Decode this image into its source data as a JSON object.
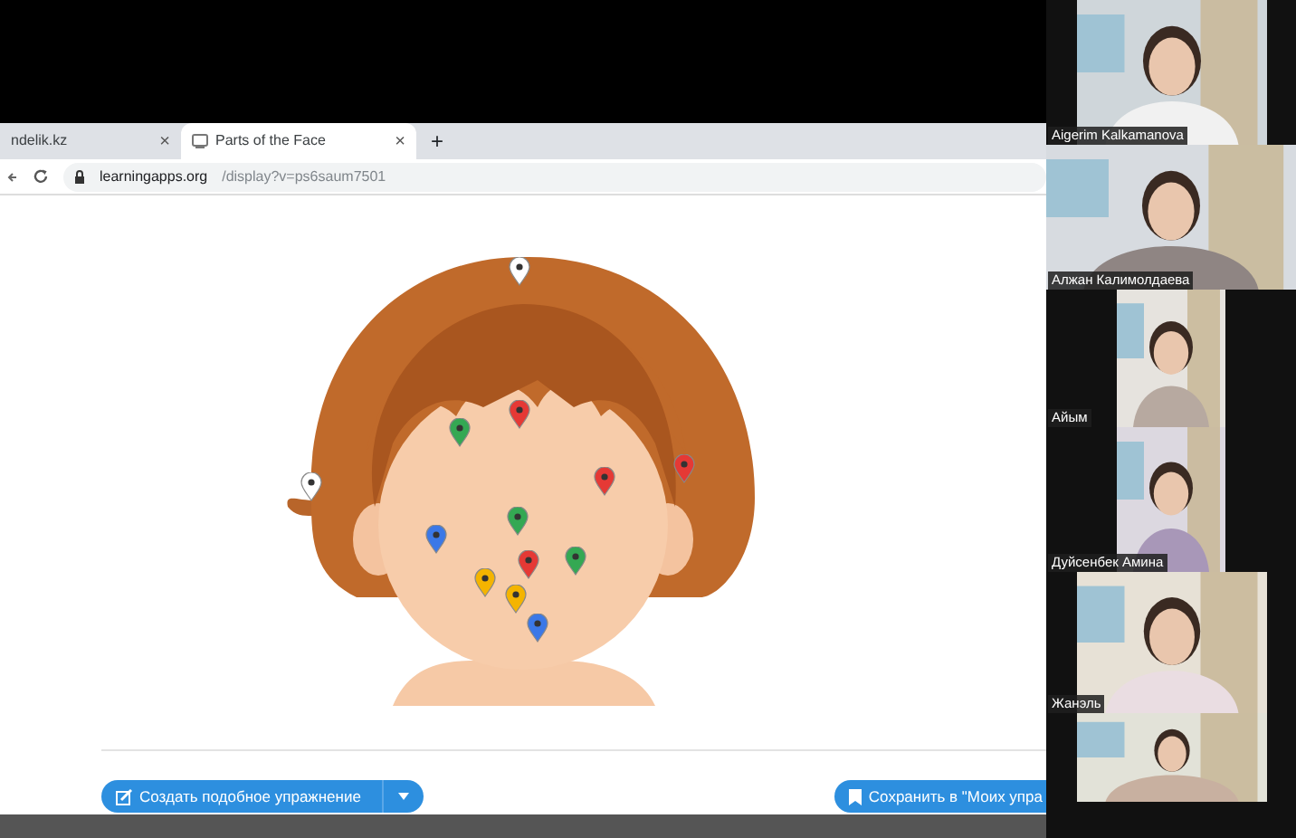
{
  "browser": {
    "tabs": [
      {
        "label": "ndelik.kz",
        "close": "×",
        "selected": false
      },
      {
        "label": "Parts of the Face",
        "close": "×",
        "selected": true
      }
    ],
    "new_tab": "+",
    "address": {
      "host": "learningapps.org",
      "path": "/display?v=ps6saum7501"
    }
  },
  "exercise": {
    "pins": [
      {
        "color": "#ffffff"
      },
      {
        "color": "#34a853"
      },
      {
        "color": "#e53935"
      },
      {
        "color": "#e53935"
      },
      {
        "color": "#e53935"
      },
      {
        "color": "#ffffff"
      },
      {
        "color": "#34a853"
      },
      {
        "color": "#3b78e7"
      },
      {
        "color": "#e53935"
      },
      {
        "color": "#34a853"
      },
      {
        "color": "#f4b400"
      },
      {
        "color": "#f4b400"
      },
      {
        "color": "#3b78e7"
      }
    ],
    "buttons": [
      {
        "label": "Создать подобное упражнение",
        "kind": "create"
      },
      {
        "label": "Сохранить в \"Моих упра",
        "kind": "save"
      }
    ]
  },
  "participants": [
    {
      "kind": "video",
      "name": "Aigerim Kalkamanova"
    },
    {
      "kind": "video",
      "name": "Алжан Калимолдаева"
    },
    {
      "kind": "video",
      "name": "Айым"
    },
    {
      "kind": "video",
      "name": "Дуйсенбек Амина"
    },
    {
      "kind": "video",
      "name": "Жанэль"
    },
    {
      "kind": "video"
    }
  ]
}
